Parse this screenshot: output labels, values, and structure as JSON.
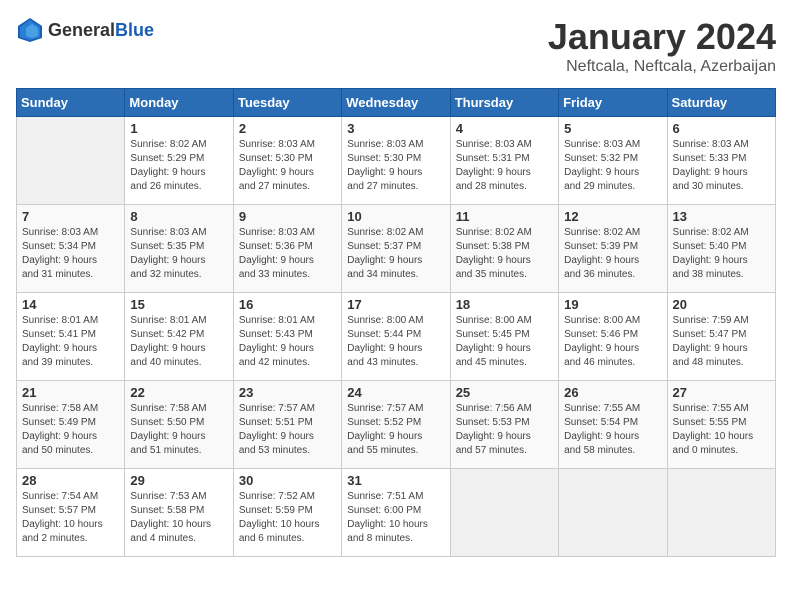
{
  "header": {
    "logo": {
      "general": "General",
      "blue": "Blue"
    },
    "title": "January 2024",
    "subtitle": "Neftcala, Neftcala, Azerbaijan"
  },
  "days_of_week": [
    "Sunday",
    "Monday",
    "Tuesday",
    "Wednesday",
    "Thursday",
    "Friday",
    "Saturday"
  ],
  "weeks": [
    [
      {
        "day": "",
        "info": ""
      },
      {
        "day": "1",
        "info": "Sunrise: 8:02 AM\nSunset: 5:29 PM\nDaylight: 9 hours\nand 26 minutes."
      },
      {
        "day": "2",
        "info": "Sunrise: 8:03 AM\nSunset: 5:30 PM\nDaylight: 9 hours\nand 27 minutes."
      },
      {
        "day": "3",
        "info": "Sunrise: 8:03 AM\nSunset: 5:30 PM\nDaylight: 9 hours\nand 27 minutes."
      },
      {
        "day": "4",
        "info": "Sunrise: 8:03 AM\nSunset: 5:31 PM\nDaylight: 9 hours\nand 28 minutes."
      },
      {
        "day": "5",
        "info": "Sunrise: 8:03 AM\nSunset: 5:32 PM\nDaylight: 9 hours\nand 29 minutes."
      },
      {
        "day": "6",
        "info": "Sunrise: 8:03 AM\nSunset: 5:33 PM\nDaylight: 9 hours\nand 30 minutes."
      }
    ],
    [
      {
        "day": "7",
        "info": "Sunrise: 8:03 AM\nSunset: 5:34 PM\nDaylight: 9 hours\nand 31 minutes."
      },
      {
        "day": "8",
        "info": "Sunrise: 8:03 AM\nSunset: 5:35 PM\nDaylight: 9 hours\nand 32 minutes."
      },
      {
        "day": "9",
        "info": "Sunrise: 8:03 AM\nSunset: 5:36 PM\nDaylight: 9 hours\nand 33 minutes."
      },
      {
        "day": "10",
        "info": "Sunrise: 8:02 AM\nSunset: 5:37 PM\nDaylight: 9 hours\nand 34 minutes."
      },
      {
        "day": "11",
        "info": "Sunrise: 8:02 AM\nSunset: 5:38 PM\nDaylight: 9 hours\nand 35 minutes."
      },
      {
        "day": "12",
        "info": "Sunrise: 8:02 AM\nSunset: 5:39 PM\nDaylight: 9 hours\nand 36 minutes."
      },
      {
        "day": "13",
        "info": "Sunrise: 8:02 AM\nSunset: 5:40 PM\nDaylight: 9 hours\nand 38 minutes."
      }
    ],
    [
      {
        "day": "14",
        "info": "Sunrise: 8:01 AM\nSunset: 5:41 PM\nDaylight: 9 hours\nand 39 minutes."
      },
      {
        "day": "15",
        "info": "Sunrise: 8:01 AM\nSunset: 5:42 PM\nDaylight: 9 hours\nand 40 minutes."
      },
      {
        "day": "16",
        "info": "Sunrise: 8:01 AM\nSunset: 5:43 PM\nDaylight: 9 hours\nand 42 minutes."
      },
      {
        "day": "17",
        "info": "Sunrise: 8:00 AM\nSunset: 5:44 PM\nDaylight: 9 hours\nand 43 minutes."
      },
      {
        "day": "18",
        "info": "Sunrise: 8:00 AM\nSunset: 5:45 PM\nDaylight: 9 hours\nand 45 minutes."
      },
      {
        "day": "19",
        "info": "Sunrise: 8:00 AM\nSunset: 5:46 PM\nDaylight: 9 hours\nand 46 minutes."
      },
      {
        "day": "20",
        "info": "Sunrise: 7:59 AM\nSunset: 5:47 PM\nDaylight: 9 hours\nand 48 minutes."
      }
    ],
    [
      {
        "day": "21",
        "info": "Sunrise: 7:58 AM\nSunset: 5:49 PM\nDaylight: 9 hours\nand 50 minutes."
      },
      {
        "day": "22",
        "info": "Sunrise: 7:58 AM\nSunset: 5:50 PM\nDaylight: 9 hours\nand 51 minutes."
      },
      {
        "day": "23",
        "info": "Sunrise: 7:57 AM\nSunset: 5:51 PM\nDaylight: 9 hours\nand 53 minutes."
      },
      {
        "day": "24",
        "info": "Sunrise: 7:57 AM\nSunset: 5:52 PM\nDaylight: 9 hours\nand 55 minutes."
      },
      {
        "day": "25",
        "info": "Sunrise: 7:56 AM\nSunset: 5:53 PM\nDaylight: 9 hours\nand 57 minutes."
      },
      {
        "day": "26",
        "info": "Sunrise: 7:55 AM\nSunset: 5:54 PM\nDaylight: 9 hours\nand 58 minutes."
      },
      {
        "day": "27",
        "info": "Sunrise: 7:55 AM\nSunset: 5:55 PM\nDaylight: 10 hours\nand 0 minutes."
      }
    ],
    [
      {
        "day": "28",
        "info": "Sunrise: 7:54 AM\nSunset: 5:57 PM\nDaylight: 10 hours\nand 2 minutes."
      },
      {
        "day": "29",
        "info": "Sunrise: 7:53 AM\nSunset: 5:58 PM\nDaylight: 10 hours\nand 4 minutes."
      },
      {
        "day": "30",
        "info": "Sunrise: 7:52 AM\nSunset: 5:59 PM\nDaylight: 10 hours\nand 6 minutes."
      },
      {
        "day": "31",
        "info": "Sunrise: 7:51 AM\nSunset: 6:00 PM\nDaylight: 10 hours\nand 8 minutes."
      },
      {
        "day": "",
        "info": ""
      },
      {
        "day": "",
        "info": ""
      },
      {
        "day": "",
        "info": ""
      }
    ]
  ]
}
